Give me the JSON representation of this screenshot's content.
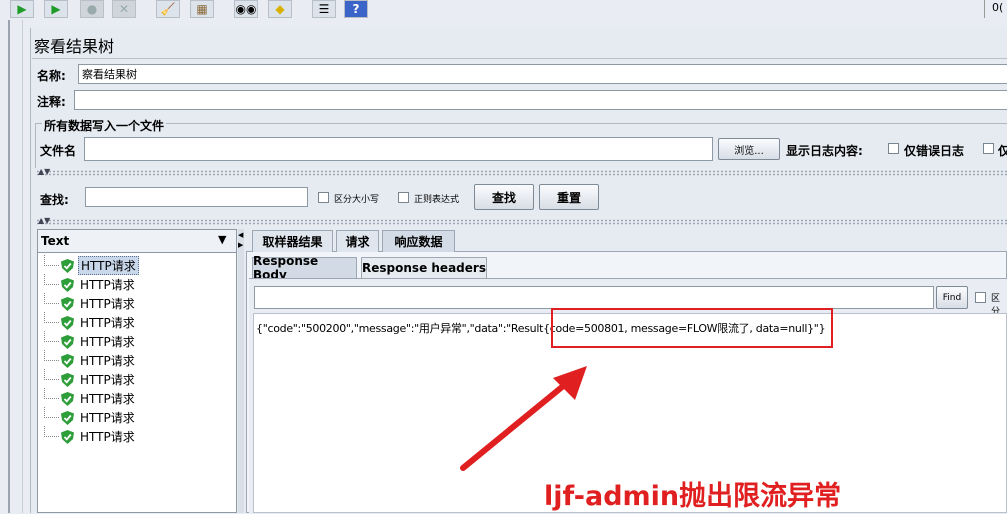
{
  "toolbar": {
    "buttons": [
      "play-icon",
      "play-no-pause-icon",
      "stop-icon",
      "shutdown-icon",
      "broom-icon",
      "broom-all-icon",
      "binoculars-icon",
      "reset-search-icon",
      "function-helper-icon",
      "help-icon"
    ],
    "right_text": "0("
  },
  "panel": {
    "title": "察看结果树",
    "name_label": "名称:",
    "name_value": "察看结果树",
    "comment_label": "注释:",
    "comment_value": "",
    "file_section_title": "所有数据写入一个文件",
    "filename_label": "文件名",
    "filename_value": "",
    "browse_label": "浏览...",
    "log_label": "显示日志内容:",
    "errors_only_label": "仅错误日志",
    "success_only_partial": "仅"
  },
  "search": {
    "label": "查找:",
    "value": "",
    "case_label": "区分大小写",
    "regex_label": "正则表达式",
    "find_button": "查找",
    "reset_button": "重置"
  },
  "tree": {
    "renderer": "Text",
    "items": [
      "HTTP请求",
      "HTTP请求",
      "HTTP请求",
      "HTTP请求",
      "HTTP请求",
      "HTTP请求",
      "HTTP请求",
      "HTTP请求",
      "HTTP请求",
      "HTTP请求"
    ]
  },
  "result": {
    "tabs": [
      "取样器结果",
      "请求",
      "响应数据"
    ],
    "subtabs": [
      "Response Body",
      "Response headers"
    ],
    "find_value": "",
    "find_button": "Find",
    "find_case_partial": "区分",
    "body_text": "{\"code\":\"500200\",\"message\":\"用户异常\",\"data\":\"Result{code=500801, message=FLOW限流了, data=null}\"}"
  },
  "annotation": {
    "text": "ljf-admin抛出限流异常",
    "color": "#e02020"
  }
}
